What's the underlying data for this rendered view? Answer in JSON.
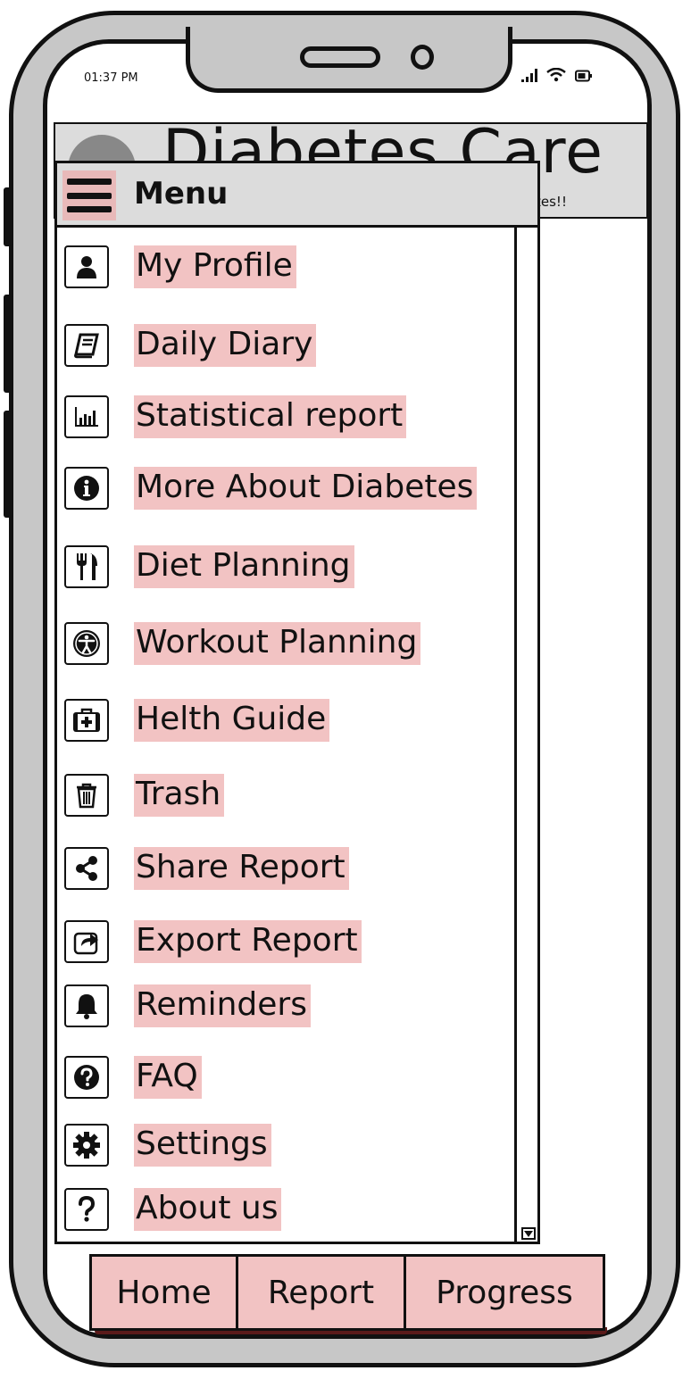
{
  "status_bar": {
    "time": "01:37 PM"
  },
  "app": {
    "title": "Diabetes Care",
    "subtitle": "tes!!"
  },
  "menu": {
    "title": "Menu",
    "items": [
      {
        "label": "My Profile",
        "icon": "user-icon"
      },
      {
        "label": "Daily Diary",
        "icon": "book-icon"
      },
      {
        "label": "Statistical report",
        "icon": "bar-chart-icon"
      },
      {
        "label": "More About Diabetes",
        "icon": "info-icon"
      },
      {
        "label": "Diet Planning",
        "icon": "cutlery-icon"
      },
      {
        "label": "Workout Planning",
        "icon": "accessibility-icon"
      },
      {
        "label": "Helth Guide",
        "icon": "medkit-icon"
      },
      {
        "label": "Trash",
        "icon": "trash-icon"
      },
      {
        "label": "Share Report",
        "icon": "share-icon"
      },
      {
        "label": "Export Report",
        "icon": "export-icon"
      },
      {
        "label": "Reminders",
        "icon": "bell-icon"
      },
      {
        "label": "FAQ",
        "icon": "question-circle-icon"
      },
      {
        "label": "Settings",
        "icon": "gear-icon"
      },
      {
        "label": "About us",
        "icon": "question-icon"
      }
    ]
  },
  "bottom_nav": {
    "items": [
      {
        "label": "Home"
      },
      {
        "label": "Report"
      },
      {
        "label": "Progress"
      }
    ]
  },
  "colors": {
    "highlight": "#f2c3c3",
    "header": "#dcdcdc",
    "frame": "#c7c7c7"
  }
}
